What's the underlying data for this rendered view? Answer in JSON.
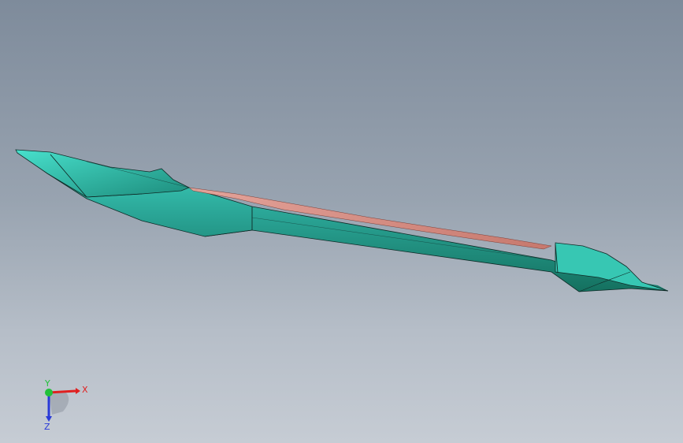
{
  "viewport": {
    "background_top": "#7e8b9b",
    "background_bottom": "#c6ccd4"
  },
  "model": {
    "name": "hull-solid",
    "hull_color": "#2aa596",
    "hull_highlight": "#3fd6c2",
    "hull_shadow": "#14705f",
    "deck_accent_color": "#d98a80",
    "edge_color": "#0f2a26"
  },
  "triad": {
    "x_label": "X",
    "y_label": "Y",
    "z_label": "Z",
    "x_color": "#e02020",
    "y_color": "#22c03a",
    "z_color": "#2a3ad8"
  }
}
